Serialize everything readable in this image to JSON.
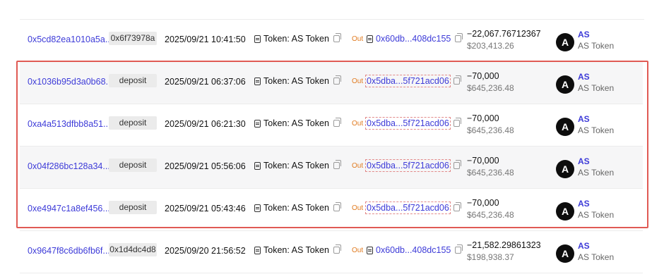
{
  "token_label": "Token: AS Token",
  "direction_label": "Out",
  "rows": [
    {
      "hash": "0x5cd82ea1010a5a...",
      "method": "0x6f73978a",
      "time": "2025/09/21 10:41:50",
      "to": "0x60db...408dc155",
      "amount": "−22,067.76712367",
      "usd": "$203,413.26",
      "symbol": "AS",
      "token_name": "AS Token",
      "avatar_letter": "A"
    },
    {
      "hash": "0x1036b95d3a0b68...",
      "method": "deposit",
      "time": "2025/09/21 06:37:06",
      "to": "0x5dba...5f721acd06",
      "amount": "−70,000",
      "usd": "$645,236.48",
      "symbol": "AS",
      "token_name": "AS Token",
      "avatar_letter": "A"
    },
    {
      "hash": "0xa4a513dfbb8a51...",
      "method": "deposit",
      "time": "2025/09/21 06:21:30",
      "to": "0x5dba...5f721acd06",
      "amount": "−70,000",
      "usd": "$645,236.48",
      "symbol": "AS",
      "token_name": "AS Token",
      "avatar_letter": "A"
    },
    {
      "hash": "0x04f286bc128a34...",
      "method": "deposit",
      "time": "2025/09/21 05:56:06",
      "to": "0x5dba...5f721acd06",
      "amount": "−70,000",
      "usd": "$645,236.48",
      "symbol": "AS",
      "token_name": "AS Token",
      "avatar_letter": "A"
    },
    {
      "hash": "0xe4947c1a8ef456...",
      "method": "deposit",
      "time": "2025/09/21 05:43:46",
      "to": "0x5dba...5f721acd06",
      "amount": "−70,000",
      "usd": "$645,236.48",
      "symbol": "AS",
      "token_name": "AS Token",
      "avatar_letter": "A"
    },
    {
      "hash": "0x9647f8c6db6fb6f...",
      "method": "0x1d4dc4d8",
      "time": "2025/09/20 21:56:52",
      "to": "0x60db...408dc155",
      "amount": "−21,582.29861323",
      "usd": "$198,938.37",
      "symbol": "AS",
      "token_name": "AS Token",
      "avatar_letter": "A"
    }
  ],
  "colors": {
    "link": "#3d3bd8",
    "out": "#e07a1f",
    "highlight_border": "#e05a54",
    "shaded_row": "#f6f6f7"
  }
}
